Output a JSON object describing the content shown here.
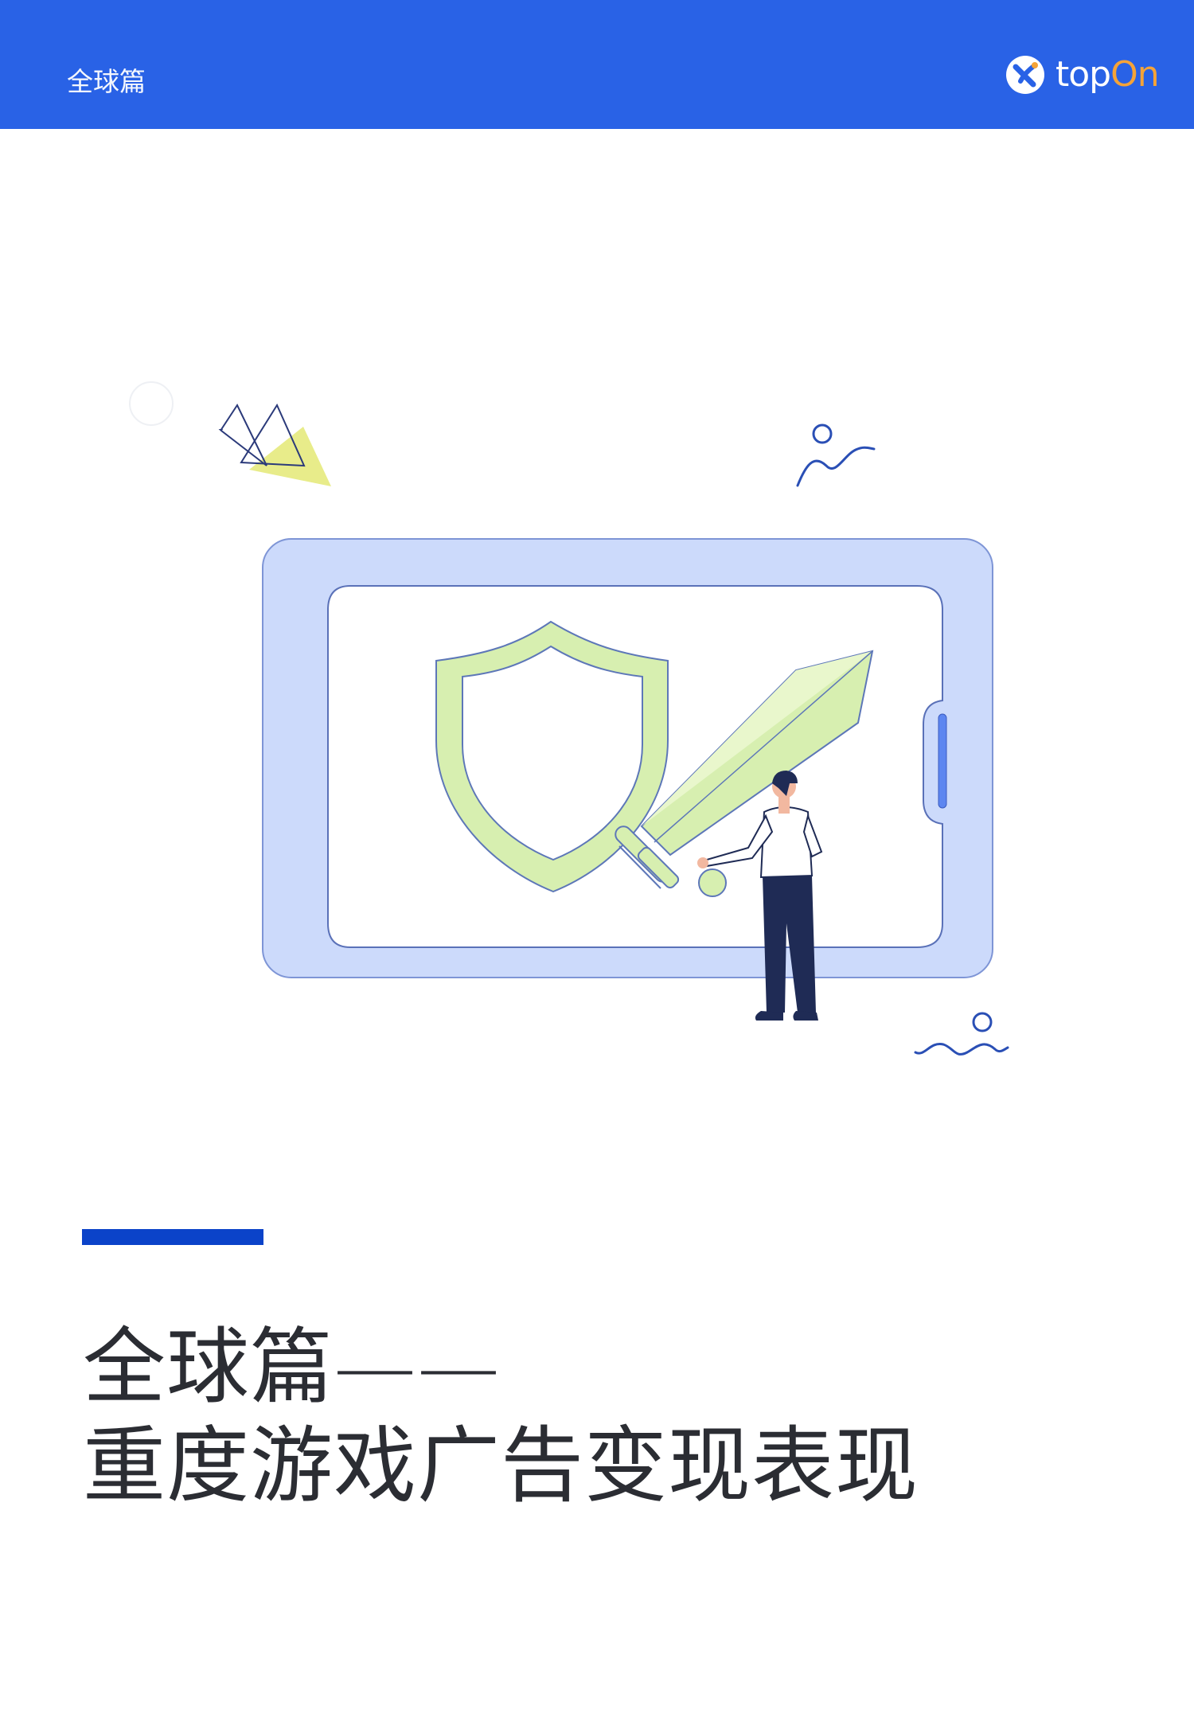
{
  "header": {
    "section_label": "全球篇",
    "brand": {
      "part1": "top",
      "part2": "On"
    }
  },
  "cover": {
    "title_line1": "全球篇——",
    "title_line2": "重度游戏广告变现表现"
  },
  "colors": {
    "header_bg": "#2962e6",
    "accent_bar": "#0b43c9",
    "brand_orange": "#f5a338",
    "title_text": "#2b2d33"
  },
  "icons": [
    "topon-logo-icon",
    "shield-icon",
    "sword-icon"
  ]
}
